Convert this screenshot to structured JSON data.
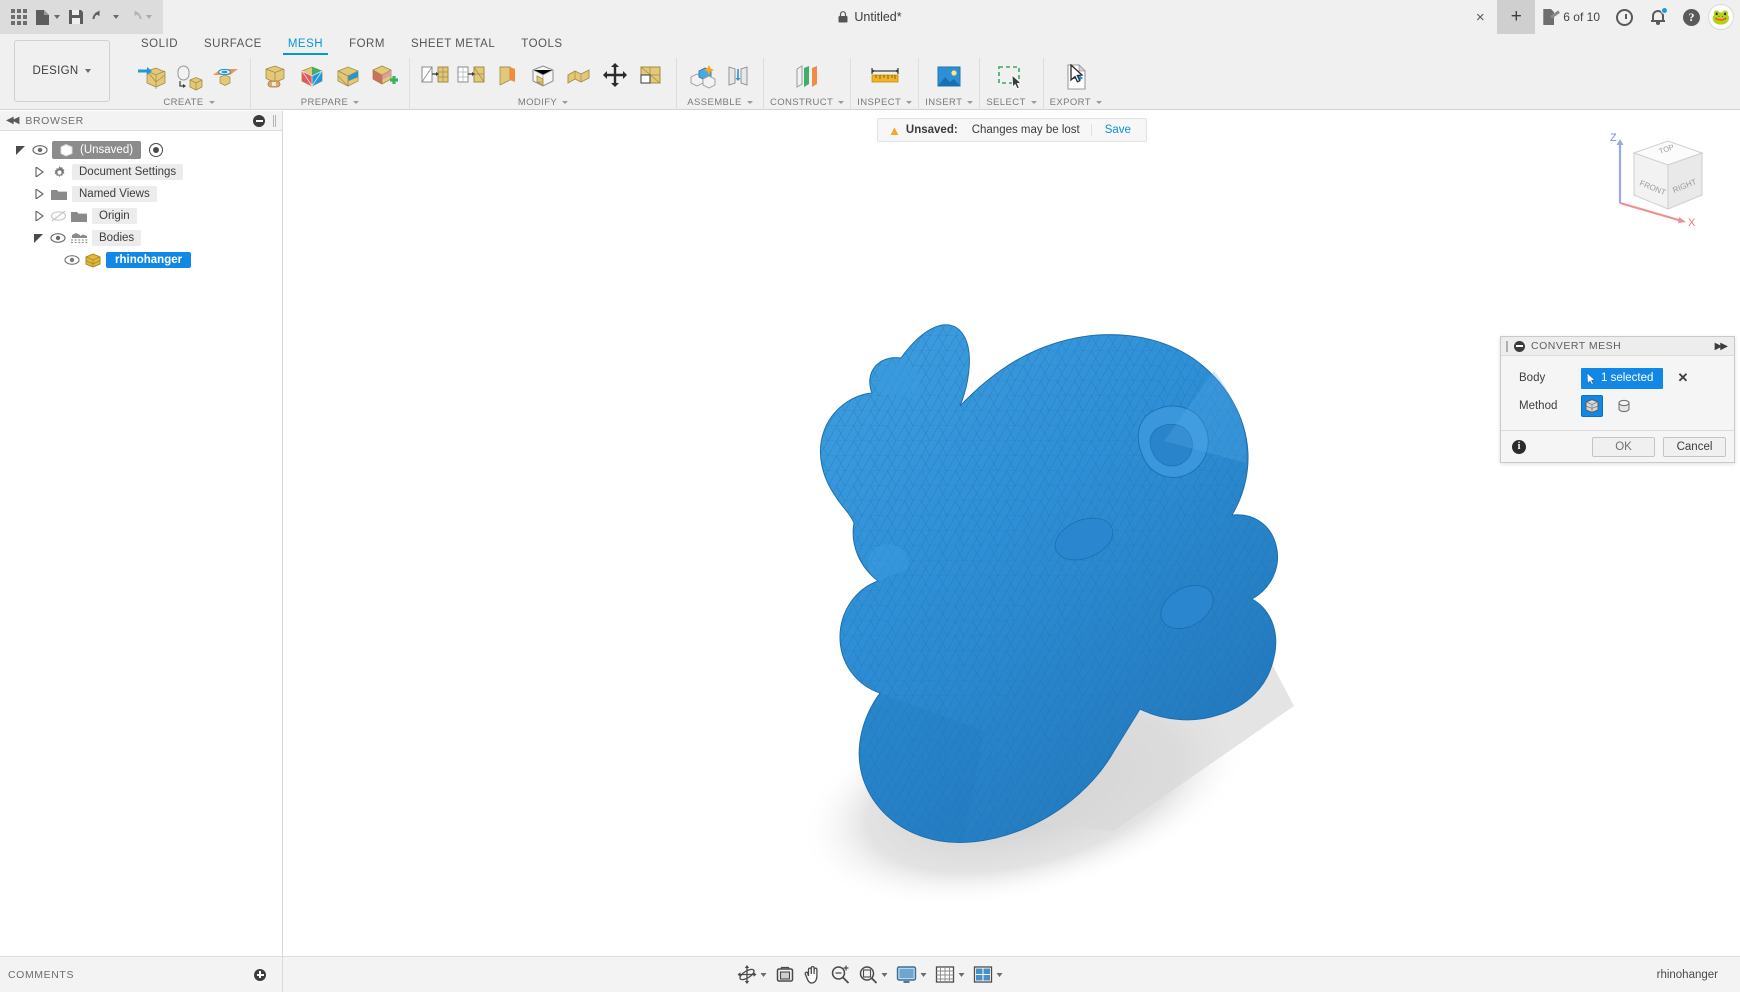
{
  "titlebar": {
    "document_title": "Untitled*",
    "lock_icon": "lock-icon",
    "apps_icon": "apps-grid-icon",
    "new_icon": "new-document-icon",
    "save_icon": "save-icon",
    "undo_icon": "undo-icon",
    "redo_icon": "redo-icon",
    "close_label": "×",
    "newtab_label": "+",
    "job_status": "6 of 10",
    "job_icon": "job-status-icon",
    "history_icon": "clock-history-icon",
    "notification_icon": "bell-icon",
    "help_icon": "help-icon",
    "avatar_icon": "frog-avatar",
    "avatar_glyph": "🐸"
  },
  "ribbon": {
    "workspace": "DESIGN",
    "tabs": [
      {
        "label": "SOLID",
        "active": false
      },
      {
        "label": "SURFACE",
        "active": false
      },
      {
        "label": "MESH",
        "active": true
      },
      {
        "label": "FORM",
        "active": false
      },
      {
        "label": "SHEET METAL",
        "active": false
      },
      {
        "label": "TOOLS",
        "active": false
      }
    ],
    "panels": [
      {
        "label": "CREATE",
        "has_caret": true,
        "tools": [
          "create-mesh-icon",
          "mesh-to-brep-icon",
          "mesh-plane-icon"
        ]
      },
      {
        "label": "PREPARE",
        "has_caret": true,
        "tools": [
          "mesh-repair-icon",
          "mesh-remesh-icon",
          "mesh-reduce-icon",
          "mesh-merge-icon"
        ]
      },
      {
        "label": "MODIFY",
        "has_caret": true,
        "tools": [
          "mesh-plane-cut-icon",
          "mesh-separate-icon",
          "mesh-reverse-normal-icon",
          "mesh-delete-faces-icon",
          "mesh-extrude-icon",
          "mesh-move-icon",
          "mesh-section-icon"
        ]
      },
      {
        "label": "ASSEMBLE",
        "has_caret": true,
        "tools": [
          "new-component-icon",
          "joint-icon"
        ]
      },
      {
        "label": "CONSTRUCT",
        "has_caret": true,
        "tools": [
          "offset-plane-icon"
        ]
      },
      {
        "label": "INSPECT",
        "has_caret": true,
        "tools": [
          "measure-icon"
        ]
      },
      {
        "label": "INSERT",
        "has_caret": true,
        "tools": [
          "insert-image-icon"
        ]
      },
      {
        "label": "SELECT",
        "has_caret": true,
        "tools": [
          "select-window-icon"
        ]
      },
      {
        "label": "EXPORT",
        "has_caret": true,
        "tools": [
          "export-icon"
        ]
      }
    ]
  },
  "browser": {
    "title": "BROWSER",
    "collapse_icon": "collapse-left-icon",
    "minimize_icon": "minimize-icon",
    "tree": [
      {
        "label": "(Unsaved)",
        "icon": "document-icon",
        "indent": 0,
        "expander": "down",
        "eye": true,
        "selected": false,
        "root": true,
        "target": true
      },
      {
        "label": "Document Settings",
        "icon": "gear-icon",
        "indent": 1,
        "expander": "right",
        "eye": false,
        "selected": false
      },
      {
        "label": "Named Views",
        "icon": "folder-icon",
        "indent": 1,
        "expander": "right",
        "eye": false,
        "selected": false
      },
      {
        "label": "Origin",
        "icon": "folder-icon",
        "indent": 1,
        "expander": "right",
        "eye": "hidden",
        "selected": false
      },
      {
        "label": "Bodies",
        "icon": "bodies-icon",
        "indent": 1,
        "expander": "down",
        "eye": true,
        "selected": false
      },
      {
        "label": "rhinohanger",
        "icon": "mesh-body-icon",
        "indent": 2,
        "expander": "none",
        "eye": true,
        "selected": true
      }
    ]
  },
  "canvas": {
    "unsaved": {
      "warning_icon": "warning-triangle-icon",
      "label": "Unsaved:",
      "message": "Changes may be lost",
      "save_label": "Save"
    },
    "viewcube": {
      "name": "view-cube",
      "faces": {
        "top": "TOP",
        "front": "FRONT",
        "right": "RIGHT"
      },
      "axes": {
        "z": "Z",
        "x": "X"
      }
    },
    "model": {
      "name": "rhinohanger-mesh-body",
      "color": "#2e8fd6",
      "shadow_color": "#d0d0d0"
    }
  },
  "dialog": {
    "title": "CONVERT MESH",
    "collapse_icon": "collapse-icon",
    "forward_icon": "forward-arrows-icon",
    "rows": [
      {
        "label": "Body",
        "type": "selection",
        "value": "1 selected",
        "cursor_icon": "cursor-select-icon",
        "clear_icon": "clear-selection-icon"
      },
      {
        "label": "Method",
        "type": "toggle",
        "options": [
          "faceted-method-icon",
          "organic-method-icon"
        ],
        "selected_index": 0
      }
    ],
    "info_icon": "info-icon",
    "ok_label": "OK",
    "cancel_label": "Cancel",
    "accent_color": "#1288e6"
  },
  "bottom": {
    "comments_label": "COMMENTS",
    "comments_add_icon": "add-comment-icon",
    "nav_tools": [
      {
        "name": "orbit-icon",
        "caret": true
      },
      {
        "name": "look-at-icon",
        "caret": false
      },
      {
        "name": "pan-icon",
        "caret": false
      },
      {
        "name": "zoom-icon",
        "caret": false
      },
      {
        "name": "zoom-window-icon",
        "caret": true
      },
      {
        "name": "display-settings-icon",
        "caret": true
      },
      {
        "name": "grid-snaps-icon",
        "caret": true
      },
      {
        "name": "viewport-layout-icon",
        "caret": true
      }
    ],
    "document_name": "rhinohanger"
  }
}
